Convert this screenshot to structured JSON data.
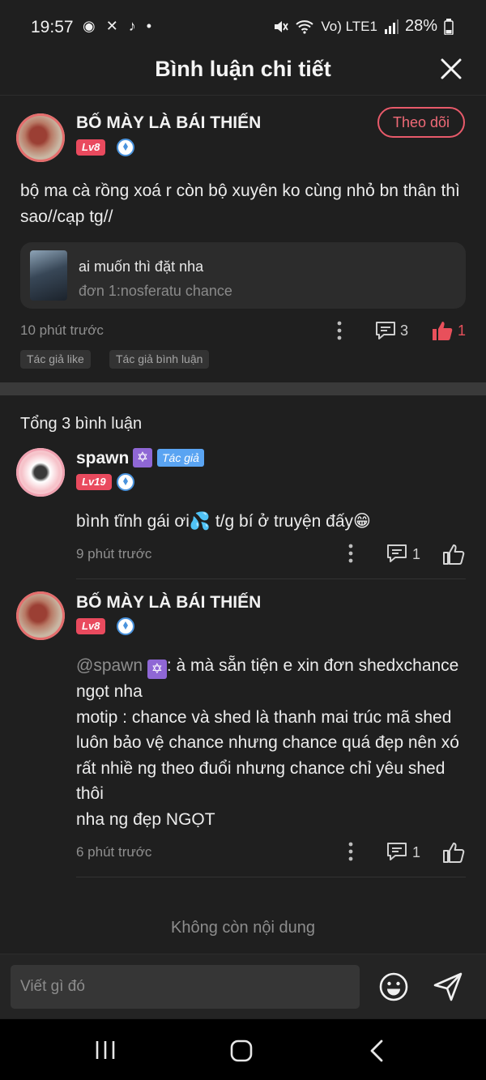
{
  "status_bar": {
    "time": "19:57",
    "left_icons": "◉ ✕ ♪ •",
    "network": "Vo) LTE1",
    "battery": "28%"
  },
  "header": {
    "title": "Bình luận chi tiết"
  },
  "post": {
    "author": "BỐ MÀY LÀ BÁI THIẾN",
    "level": "Lv8",
    "follow_label": "Theo dõi",
    "text": "bộ ma cà rồng xoá r còn bộ xuyên ko cùng nhỏ bn thân thì sao//cạp tg//",
    "story_card": {
      "title": "ai muốn thì đặt nha",
      "subtitle": "đơn 1:nosferatu chance"
    },
    "time": "10 phút trước",
    "comment_count": "3",
    "like_count": "1",
    "tags": [
      "Tác giả like",
      "Tác giả bình luận"
    ]
  },
  "comments_section": {
    "total": "Tổng 3 bình luận",
    "comments": [
      {
        "author": "spawn",
        "star": "✡",
        "author_tag": "Tác giả",
        "level": "Lv19",
        "text": "bình tĩnh gái ơi💦 t/g bí ở truyện đấy😁",
        "time": "9 phút trước",
        "reply_count": "1"
      },
      {
        "author": "BỐ MÀY LÀ BÁI THIẾN",
        "level": "Lv8",
        "mention": "@spawn",
        "mention_star": "✡",
        "text_first": ": à mà sẵn tiện e xin đơn shedxchance ngọt nha",
        "text_rest": "motip : chance và shed là thanh mai trúc mã shed luôn bảo vệ chance nhưng chance quá đẹp nên xó rất nhiề ng theo đuổi nhưng chance chỉ yêu shed thôi",
        "text_last": "nha ng đẹp NGỌT",
        "time": "6 phút trước",
        "reply_count": "1"
      }
    ],
    "end_text": "Không còn nội dung"
  },
  "input": {
    "placeholder": "Viết gì đó"
  },
  "colors": {
    "accent": "#e94a5e",
    "like": "#e8505b",
    "verified": "#4a93dd",
    "author_tag": "#5aa4f2",
    "star_badge": "#8f67d5"
  }
}
